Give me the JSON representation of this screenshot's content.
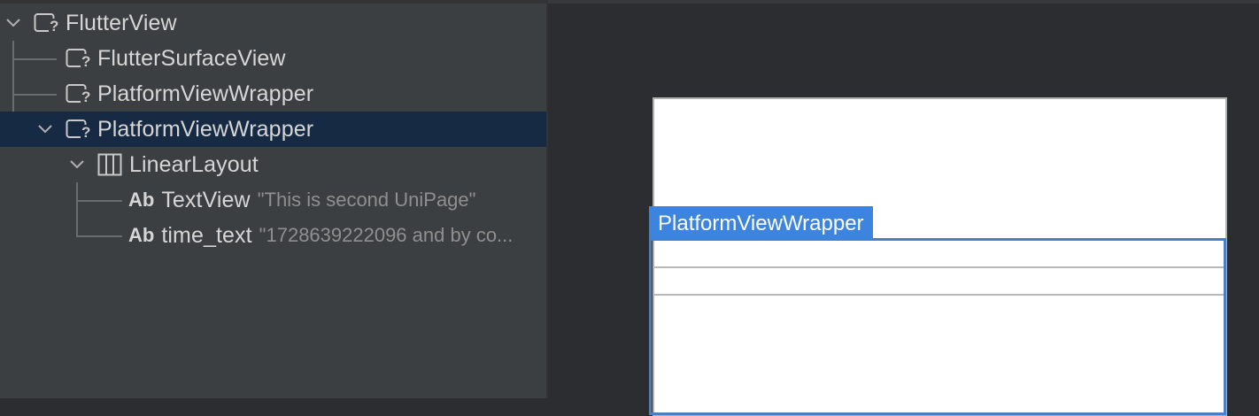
{
  "tree": {
    "nodes": [
      {
        "label": "FlutterView",
        "icon": "unknown-view-icon",
        "expanded": true
      },
      {
        "label": "FlutterSurfaceView",
        "icon": "unknown-view-icon"
      },
      {
        "label": "PlatformViewWrapper",
        "icon": "unknown-view-icon"
      },
      {
        "label": "PlatformViewWrapper",
        "icon": "unknown-view-icon",
        "expanded": true,
        "selected": true
      },
      {
        "label": "LinearLayout",
        "icon": "linear-layout-icon",
        "expanded": true
      },
      {
        "prefix": "Ab",
        "label": "TextView",
        "desc": "\"This is second UniPage\"",
        "icon": "text-view-icon"
      },
      {
        "prefix": "Ab",
        "label": "time_text",
        "desc": "\"1728639222096 and by co...",
        "icon": "text-view-icon"
      }
    ]
  },
  "preview": {
    "highlight_label": "PlatformViewWrapper"
  },
  "colors": {
    "selection": "#162a44",
    "highlight": "#3d84de"
  }
}
